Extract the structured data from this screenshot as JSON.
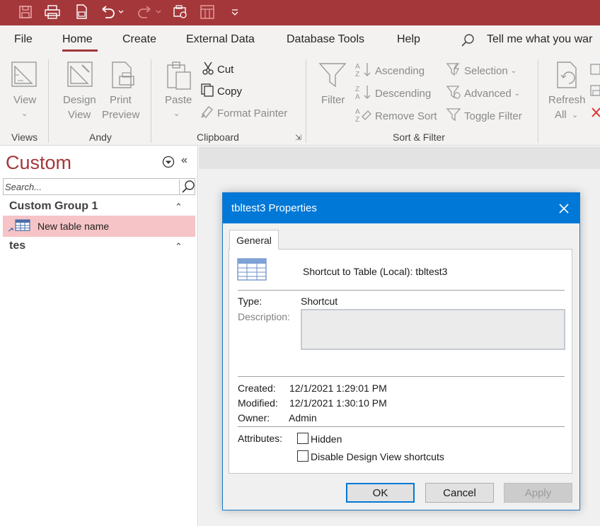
{
  "colors": {
    "brand": "#a4373a",
    "dialog_title": "#0078d7",
    "selected_item": "#f6c4c6"
  },
  "quick_access": [
    "save-icon",
    "print-icon",
    "print-preview-icon",
    "undo-icon",
    "redo-icon",
    "form-icon",
    "layout-icon",
    "customize-icon"
  ],
  "menu": {
    "tabs": [
      "File",
      "Home",
      "Create",
      "External Data",
      "Database Tools",
      "Help"
    ],
    "active": "Home",
    "tell_me": "Tell me what you war"
  },
  "ribbon": {
    "views": {
      "view": "View",
      "group": "Views"
    },
    "andy": {
      "design_view_1": "Design",
      "design_view_2": "View",
      "print_preview_1": "Print",
      "print_preview_2": "Preview",
      "group": "Andy"
    },
    "clipboard": {
      "paste": "Paste",
      "cut": "Cut",
      "copy": "Copy",
      "format_painter": "Format Painter",
      "group": "Clipboard"
    },
    "sort_filter": {
      "filter": "Filter",
      "ascending": "Ascending",
      "descending": "Descending",
      "remove_sort": "Remove Sort",
      "selection": "Selection",
      "advanced": "Advanced",
      "toggle_filter": "Toggle Filter",
      "group": "Sort & Filter"
    },
    "records": {
      "refresh_1": "Refresh",
      "refresh_2": "All"
    }
  },
  "nav": {
    "title": "Custom",
    "search_placeholder": "Search...",
    "groups": [
      {
        "label": "Custom Group 1",
        "items": [
          {
            "label": "New table name"
          }
        ]
      },
      {
        "label": "tes",
        "items": []
      }
    ]
  },
  "dialog": {
    "title": "tbltest3 Properties",
    "tab": "General",
    "heading": "Shortcut to Table (Local): tbltest3",
    "type_label": "Type:",
    "type_value": "Shortcut",
    "description_label": "Description:",
    "description_value": "",
    "created_label": "Created:",
    "created_value": "12/1/2021 1:29:01 PM",
    "modified_label": "Modified:",
    "modified_value": "12/1/2021 1:30:10 PM",
    "owner_label": "Owner:",
    "owner_value": "Admin",
    "attributes_label": "Attributes:",
    "hidden_label": "Hidden",
    "hidden_checked": false,
    "disable_label": "Disable Design View shortcuts",
    "disable_checked": false,
    "ok": "OK",
    "cancel": "Cancel",
    "apply": "Apply"
  }
}
